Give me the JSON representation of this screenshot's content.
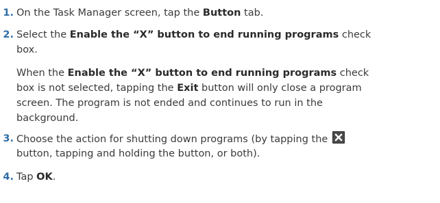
{
  "steps": [
    {
      "number": "1.",
      "lines": [
        [
          "On the Task Manager screen, tap the ",
          "Button",
          " tab."
        ]
      ]
    },
    {
      "number": "2.",
      "lines": [
        [
          "Select the ",
          "Enable the “X” button to end running programs",
          " check"
        ],
        [
          "box."
        ]
      ],
      "note_lines": [
        [
          "When the ",
          "Enable the “X” button to end running programs",
          " check"
        ],
        [
          "box is not selected, tapping the ",
          "Exit",
          " button will only close a program"
        ],
        [
          "screen. The program is not ended and continues to run in the"
        ],
        [
          "background."
        ]
      ]
    },
    {
      "number": "3.",
      "lines": [
        [
          "Choose the action for shutting down programs (by tapping the"
        ],
        [
          "button, tapping and holding the button, or both)."
        ]
      ]
    },
    {
      "number": "4.",
      "lines": [
        [
          "Tap ",
          "OK",
          "."
        ]
      ]
    }
  ],
  "icons": {
    "close_button_icon": "close-x-icon",
    "close_button_color": "#4a4a4a"
  },
  "accent_color": "#2f6fa6"
}
